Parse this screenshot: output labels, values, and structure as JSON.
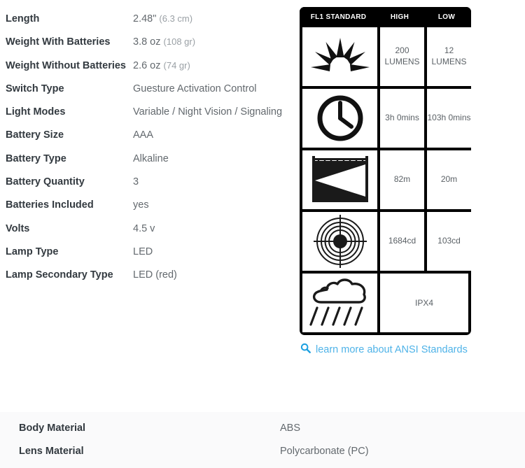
{
  "specs": {
    "rows": [
      {
        "label": "Length",
        "value": "2.48\"",
        "sub": "(6.3 cm)"
      },
      {
        "label": "Weight With Batteries",
        "value": "3.8 oz",
        "sub": "(108 gr)"
      },
      {
        "label": "Weight Without Batteries",
        "value": "2.6 oz",
        "sub": "(74 gr)"
      },
      {
        "label": "Switch Type",
        "value": "Guesture Activation Control",
        "sub": ""
      },
      {
        "label": "Light Modes",
        "value": "Variable / Night Vision / Signaling",
        "sub": ""
      },
      {
        "label": "Battery Size",
        "value": "AAA",
        "sub": ""
      },
      {
        "label": "Battery Type",
        "value": "Alkaline",
        "sub": ""
      },
      {
        "label": "Battery Quantity",
        "value": "3",
        "sub": ""
      },
      {
        "label": "Batteries Included",
        "value": "yes",
        "sub": ""
      },
      {
        "label": "Volts",
        "value": "4.5 v",
        "sub": ""
      },
      {
        "label": "Lamp Type",
        "value": "LED",
        "sub": ""
      },
      {
        "label": "Lamp Secondary Type",
        "value": "LED (red)",
        "sub": ""
      }
    ]
  },
  "fl1_table": {
    "headers": {
      "standard": "FL1 STANDARD",
      "high": "HIGH",
      "low": "LOW"
    },
    "rows": [
      {
        "icon": "light-output-sunburst-icon",
        "high": "200\nLUMENS",
        "low": "12\nLUMENS",
        "span": false
      },
      {
        "icon": "run-time-clock-icon",
        "high": "3h 0mins",
        "low": "103h 0mins",
        "span": false
      },
      {
        "icon": "beam-distance-icon",
        "high": "82m",
        "low": "20m",
        "span": false
      },
      {
        "icon": "peak-beam-intensity-icon",
        "high": "1684cd",
        "low": "103cd",
        "span": false
      },
      {
        "icon": "water-resistance-rain-icon",
        "high": "IPX4",
        "low": "",
        "span": true
      }
    ]
  },
  "ansi_link": {
    "icon": "search-icon",
    "label": "learn more about ANSI Standards"
  },
  "bottom": {
    "rows": [
      {
        "label": "Body Material",
        "value": "ABS"
      },
      {
        "label": "Lens Material",
        "value": "Polycarbonate (PC)"
      }
    ]
  },
  "colors": {
    "table_background": "#000000",
    "link_blue": "#4fb3e8",
    "label_text": "#333a40",
    "value_text": "#63696e",
    "sub_text": "#9aa0a5",
    "bottom_panel_bg": "#fafafb"
  }
}
